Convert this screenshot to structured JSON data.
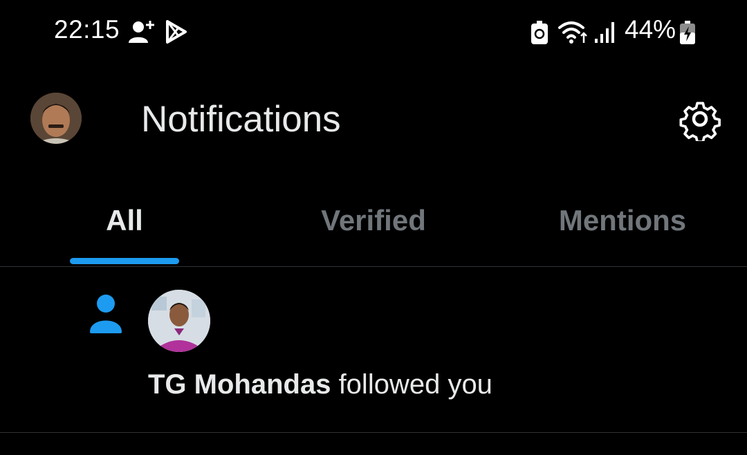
{
  "status_bar": {
    "time": "22:15",
    "battery_percent": "44%",
    "icons": [
      "add-user-icon",
      "play-store-icon",
      "battery-saver-icon",
      "wifi-icon",
      "signal-icon",
      "battery-charging-icon"
    ]
  },
  "header": {
    "title": "Notifications",
    "settings_icon": "gear-icon"
  },
  "tabs": [
    {
      "label": "All",
      "active": true
    },
    {
      "label": "Verified",
      "active": false
    },
    {
      "label": "Mentions",
      "active": false
    }
  ],
  "accent_color": "#1d9bf0",
  "notifications": [
    {
      "type_icon": "person-icon",
      "user_name": "TG Mohandas",
      "action": " followed you"
    }
  ]
}
